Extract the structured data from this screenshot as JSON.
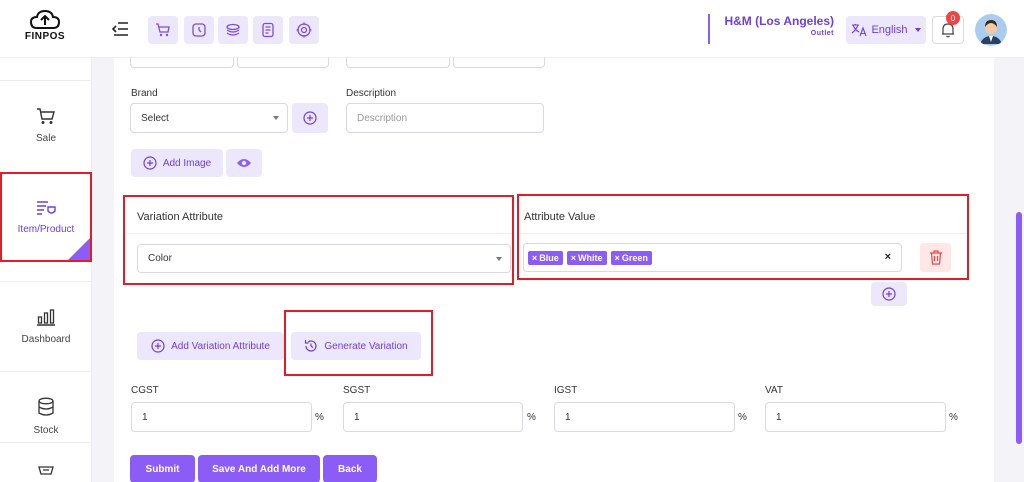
{
  "brand": {
    "name": "FINPOS"
  },
  "header": {
    "store_name": "H&M (Los Angeles)",
    "store_sub": "Outlet",
    "language": "English",
    "notification_count": "0",
    "quick_icons": [
      "cart-icon",
      "clock-icon",
      "layers-icon",
      "receipt-icon",
      "target-icon"
    ]
  },
  "sidebar": {
    "items": [
      {
        "label": "Sale",
        "icon": "cart-icon"
      },
      {
        "label": "Item/Product",
        "icon": "item-product-icon"
      },
      {
        "label": "Dashboard",
        "icon": "bar-chart-icon"
      },
      {
        "label": "Stock",
        "icon": "database-icon"
      }
    ]
  },
  "form": {
    "brand_label": "Brand",
    "brand_value": "Select",
    "description_label": "Description",
    "description_placeholder": "Description",
    "add_image_label": "Add Image",
    "variation_attribute_title": "Variation Attribute",
    "variation_attribute_value": "Color",
    "attribute_value_title": "Attribute Value",
    "attribute_tags": [
      "Blue",
      "White",
      "Green"
    ],
    "clear_symbol": "×",
    "add_variation_label": "Add Variation Attribute",
    "generate_variation_label": "Generate Variation",
    "taxes": [
      {
        "label": "CGST",
        "value": "1",
        "unit": "%"
      },
      {
        "label": "SGST",
        "value": "1",
        "unit": "%"
      },
      {
        "label": "IGST",
        "value": "1",
        "unit": "%"
      },
      {
        "label": "VAT",
        "value": "1",
        "unit": "%"
      }
    ],
    "submit_label": "Submit",
    "save_add_more_label": "Save And Add More",
    "back_label": "Back"
  },
  "colors": {
    "accent": "#8b5cf6",
    "accent_soft": "#ede7fb",
    "highlight": "#e11d2a"
  }
}
